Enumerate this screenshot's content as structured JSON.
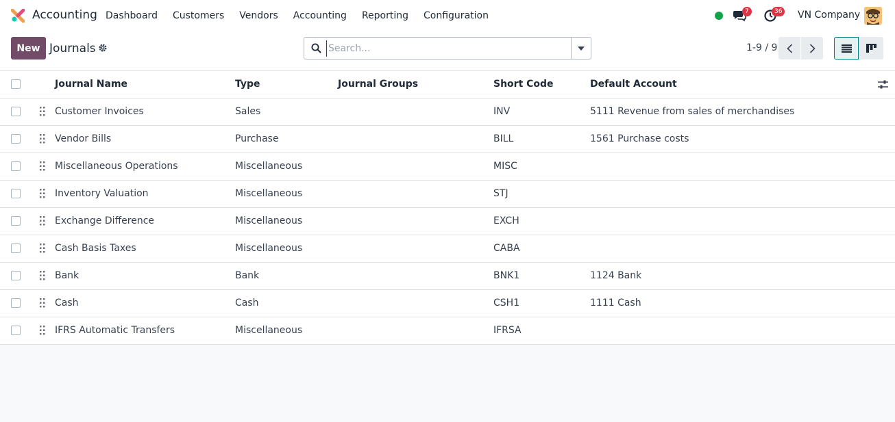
{
  "navbar": {
    "app_name": "Accounting",
    "menu": [
      "Dashboard",
      "Customers",
      "Vendors",
      "Accounting",
      "Reporting",
      "Configuration"
    ],
    "chat_badge": "7",
    "activity_badge": "36",
    "company": "VN Company",
    "status_color": "#10a34a"
  },
  "control_panel": {
    "new_label": "New",
    "title": "Journals",
    "search_placeholder": "Search...",
    "pager": "1-9 / 9"
  },
  "table": {
    "headers": {
      "name": "Journal Name",
      "type": "Type",
      "groups": "Journal Groups",
      "code": "Short Code",
      "account": "Default Account"
    },
    "rows": [
      {
        "name": "Customer Invoices",
        "type": "Sales",
        "groups": "",
        "code": "INV",
        "account": "5111 Revenue from sales of merchandises"
      },
      {
        "name": "Vendor Bills",
        "type": "Purchase",
        "groups": "",
        "code": "BILL",
        "account": "1561 Purchase costs"
      },
      {
        "name": "Miscellaneous Operations",
        "type": "Miscellaneous",
        "groups": "",
        "code": "MISC",
        "account": ""
      },
      {
        "name": "Inventory Valuation",
        "type": "Miscellaneous",
        "groups": "",
        "code": "STJ",
        "account": ""
      },
      {
        "name": "Exchange Difference",
        "type": "Miscellaneous",
        "groups": "",
        "code": "EXCH",
        "account": ""
      },
      {
        "name": "Cash Basis Taxes",
        "type": "Miscellaneous",
        "groups": "",
        "code": "CABA",
        "account": ""
      },
      {
        "name": "Bank",
        "type": "Bank",
        "groups": "",
        "code": "BNK1",
        "account": "1124 Bank"
      },
      {
        "name": "Cash",
        "type": "Cash",
        "groups": "",
        "code": "CSH1",
        "account": "1111 Cash"
      },
      {
        "name": "IFRS Automatic Transfers",
        "type": "Miscellaneous",
        "groups": "",
        "code": "IFRSA",
        "account": ""
      }
    ]
  }
}
